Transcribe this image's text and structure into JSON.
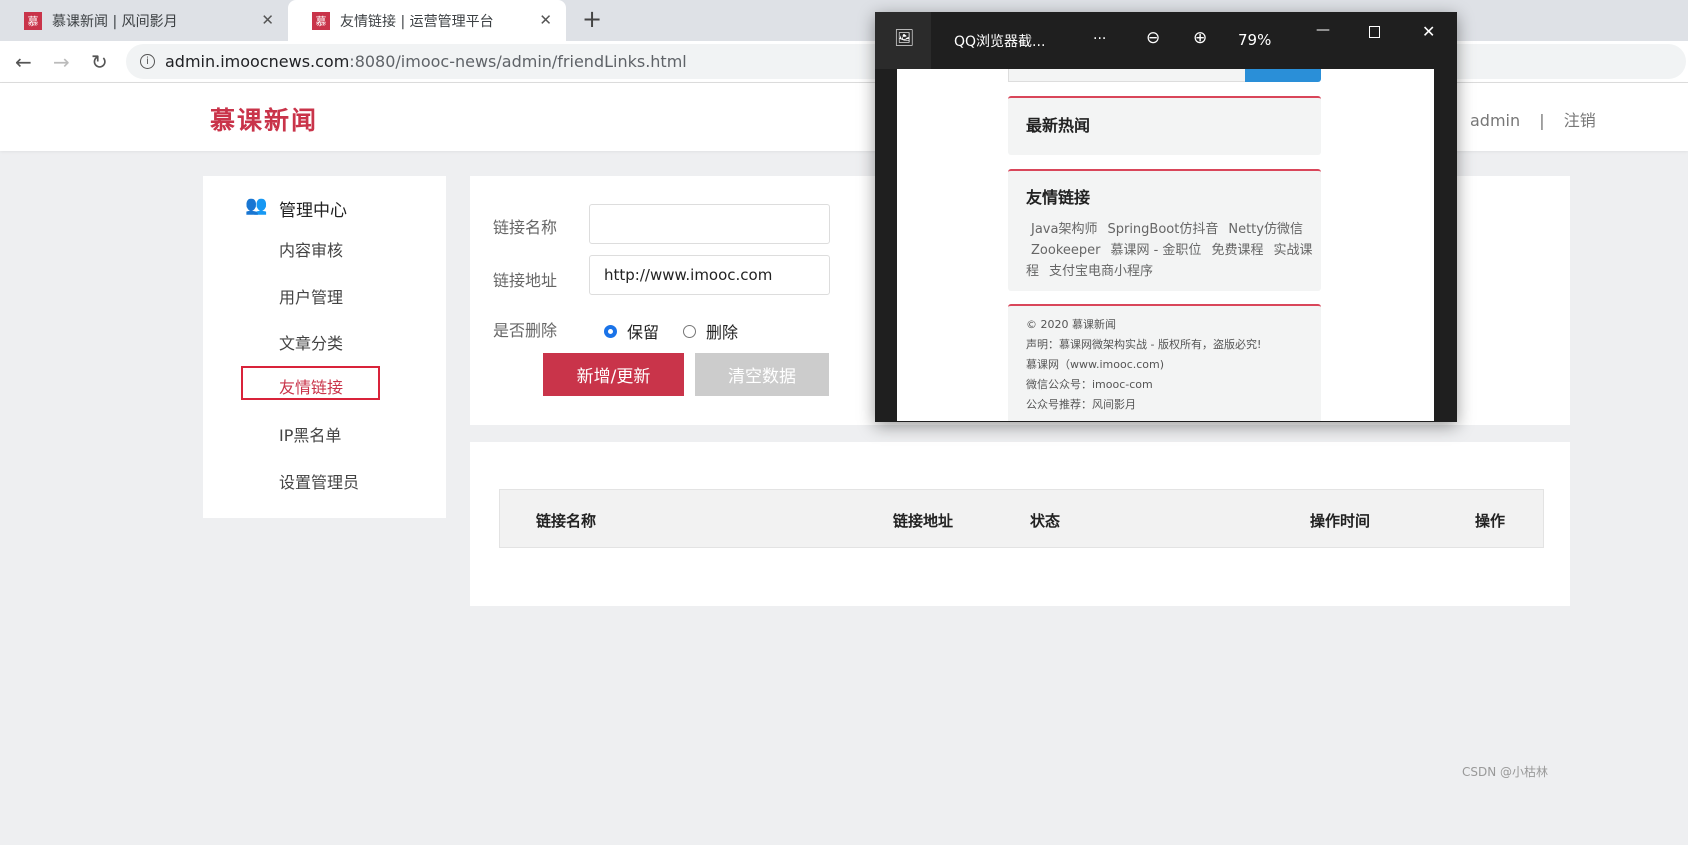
{
  "browser": {
    "tabs": [
      {
        "title": "慕课新闻 | 风间影月",
        "favicon": "慕"
      },
      {
        "title": "友情链接 | 运营管理平台",
        "favicon": "慕",
        "active": true
      }
    ],
    "url_host": "admin.imoocnews.com",
    "url_rest": ":8080/imooc-news/admin/friendLinks.html"
  },
  "header": {
    "logo": "慕课新闻",
    "user": "admin",
    "sep": "|",
    "logout": "注销"
  },
  "sidebar": {
    "title": "管理中心",
    "items": [
      {
        "label": "内容审核"
      },
      {
        "label": "用户管理"
      },
      {
        "label": "文章分类"
      },
      {
        "label": "友情链接",
        "active": true
      },
      {
        "label": "IP黑名单"
      },
      {
        "label": "设置管理员"
      }
    ]
  },
  "form": {
    "name_label": "链接名称",
    "name_value": "",
    "url_label": "链接地址",
    "url_value": "http://www.imooc.com",
    "delete_label": "是否删除",
    "opt_keep": "保留",
    "opt_delete": "删除",
    "selected": "保留",
    "submit": "新增/更新",
    "clear": "清空数据"
  },
  "table": {
    "columns": [
      "链接名称",
      "链接地址",
      "状态",
      "操作时间",
      "操作"
    ],
    "rows": []
  },
  "viewer": {
    "title": "QQ浏览器截...",
    "more": "···",
    "zoom": "79%",
    "hot_title": "最新热闻",
    "links_title": "友情链接",
    "links": [
      "Java架构师",
      "SpringBoot仿抖音",
      "Netty仿微信",
      "Zookeeper",
      "慕课网 - 金职位",
      "免费课程",
      "实战课程",
      "支付宝电商小程序"
    ],
    "footer": [
      "© 2020 慕课新闻",
      "声明：慕课网微架构实战 - 版权所有，盗版必究!",
      "慕课网（www.imooc.com)",
      "微信公众号：imooc-com",
      "公众号推荐：风间影月"
    ]
  },
  "watermark": "CSDN @小枯林",
  "colors": {
    "brand": "#c9344a",
    "disabled": "#cccccc",
    "accent": "#1a73e8"
  }
}
